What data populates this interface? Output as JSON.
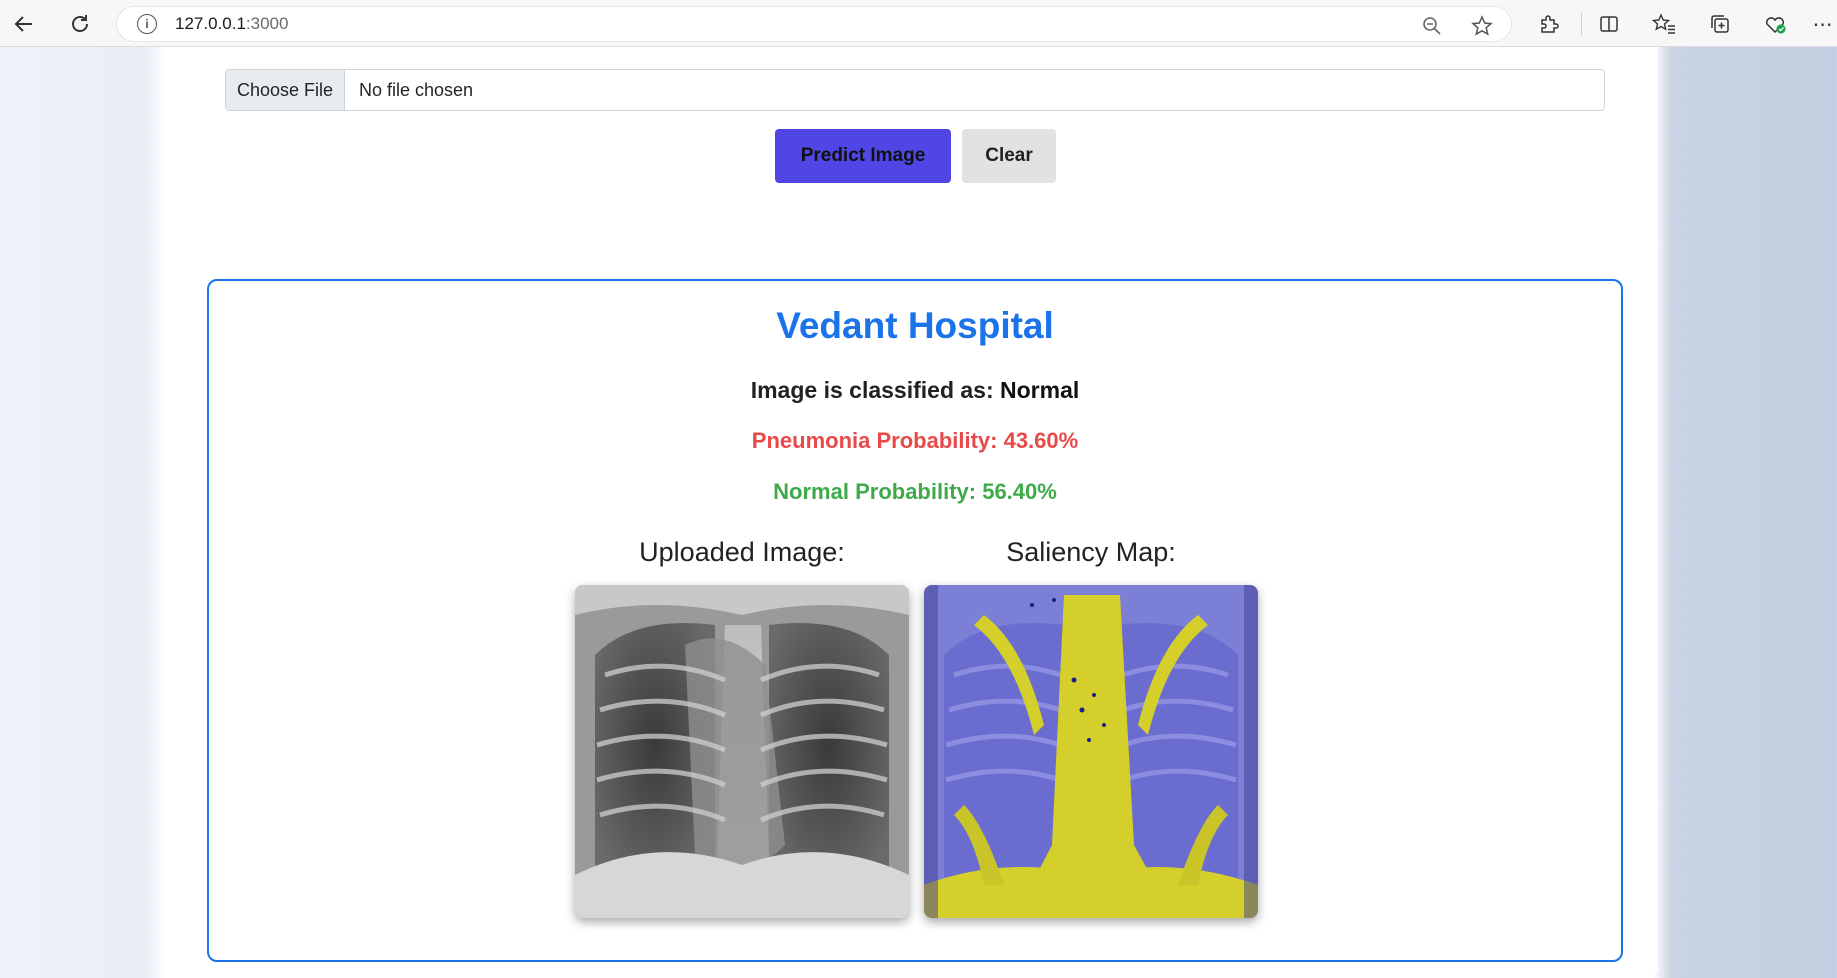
{
  "browser": {
    "url_host": "127.0.0.1",
    "url_port": ":3000"
  },
  "upload": {
    "choose_file_label": "Choose File",
    "file_status": "No file chosen"
  },
  "actions": {
    "predict_label": "Predict Image",
    "clear_label": "Clear"
  },
  "result": {
    "hospital_name": "Vedant Hospital",
    "classified_prefix": "Image is classified as: ",
    "classification": "Normal",
    "pneumonia_text": "Pneumonia Probability: 43.60%",
    "normal_text": "Normal Probability: 56.40%",
    "pneumonia_probability": 43.6,
    "normal_probability": 56.4,
    "uploaded_heading": "Uploaded Image:",
    "saliency_heading": "Saliency Map:"
  },
  "colors": {
    "accent": "#1a73e8",
    "predict_button": "#4f46e5",
    "pneumonia": "#e84a4a",
    "normal": "#3faa4a"
  },
  "icons": {
    "back": "back-arrow-icon",
    "reload": "reload-icon",
    "info": "info-icon",
    "zoom": "zoom-out-icon",
    "favorite": "star-icon",
    "extensions": "puzzle-icon",
    "split": "split-screen-icon",
    "favorites": "favorites-icon",
    "collections": "collections-icon",
    "health": "browser-essentials-icon",
    "menu": "more-icon"
  }
}
